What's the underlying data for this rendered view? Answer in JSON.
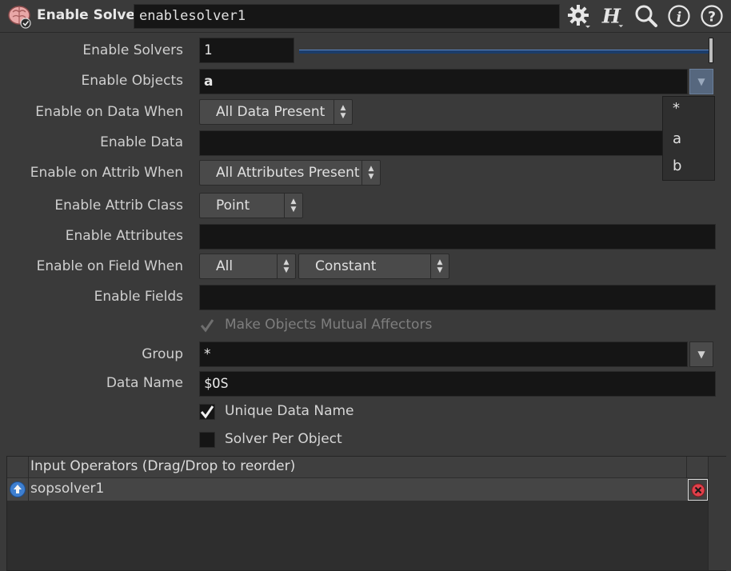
{
  "header": {
    "node_type": "Enable Solver",
    "node_name": "enablesolver1",
    "icons": [
      "brain-node-icon",
      "gear-icon",
      "houdini-help-h-icon",
      "search-icon",
      "info-icon",
      "help-icon"
    ]
  },
  "parms": {
    "enable_solvers": {
      "label": "Enable Solvers",
      "value": "1",
      "slider_fraction": 1.0
    },
    "enable_objects": {
      "label": "Enable Objects",
      "value": "a",
      "options": [
        "*",
        "a",
        "b"
      ]
    },
    "enable_on_data_when": {
      "label": "Enable on Data When",
      "value": "All Data Present"
    },
    "enable_data": {
      "label": "Enable Data",
      "value": ""
    },
    "enable_on_attrib_when": {
      "label": "Enable on Attrib When",
      "value": "All Attributes Present"
    },
    "enable_attrib_class": {
      "label": "Enable Attrib Class",
      "value": "Point"
    },
    "enable_attributes": {
      "label": "Enable Attributes",
      "value": ""
    },
    "enable_on_field_when": {
      "label": "Enable on Field When",
      "value": "All",
      "value2": "Constant"
    },
    "enable_fields": {
      "label": "Enable Fields",
      "value": ""
    },
    "mutual_affectors": {
      "label": "Make Objects Mutual Affectors",
      "checked": true,
      "enabled": false
    },
    "group": {
      "label": "Group",
      "value": "*"
    },
    "data_name": {
      "label": "Data Name",
      "value": "$OS"
    },
    "unique_data_name": {
      "label": "Unique Data Name",
      "checked": true
    },
    "solver_per_object": {
      "label": "Solver Per Object",
      "checked": false
    }
  },
  "inputs": {
    "header": "Input Operators (Drag/Drop to reorder)",
    "rows": [
      {
        "name": "sopsolver1"
      }
    ]
  },
  "colors": {
    "accent": "#5b86c4",
    "remove": "#e0404a"
  }
}
